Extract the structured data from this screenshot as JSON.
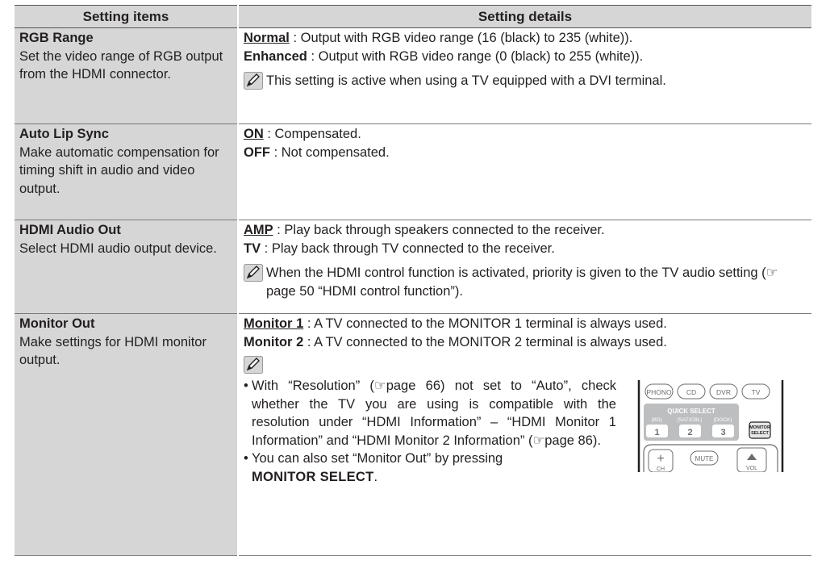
{
  "header": {
    "col1": "Setting items",
    "col2": "Setting details"
  },
  "rows": [
    {
      "title": "RGB Range",
      "desc": "Set the video range of RGB output from the HDMI connector.",
      "options": [
        {
          "key": "Normal",
          "text": " : Output with RGB video range (16 (black) to 235 (white))."
        },
        {
          "key": "Enhanced",
          "text": " : Output with RGB video range (0 (black) to 255 (white))."
        }
      ],
      "note": "This setting is active when using a TV equipped with a DVI terminal."
    },
    {
      "title": "Auto Lip Sync",
      "desc": "Make automatic compensation for timing shift in audio and video output.",
      "options": [
        {
          "key": "ON",
          "text": " : Compensated."
        },
        {
          "key": "OFF",
          "text": " : Not compensated."
        }
      ]
    },
    {
      "title": "HDMI Audio Out",
      "desc": "Select HDMI audio output device.",
      "options": [
        {
          "key": "AMP",
          "text": " : Play back through speakers connected to the receiver."
        },
        {
          "key": "TV",
          "text": " : Play back through TV connected to the receiver."
        }
      ],
      "note": "When the HDMI control function is activated, priority is given to the TV audio setting (☞page 50 “HDMI control function”)."
    },
    {
      "title": "Monitor Out",
      "desc": "Make settings for HDMI monitor output.",
      "options": [
        {
          "key": "Monitor 1",
          "text": " : A TV connected to the MONITOR 1 terminal is always used."
        },
        {
          "key": "Monitor 2",
          "text": " : A TV connected to the MONITOR 2 terminal is always used."
        }
      ],
      "bullets": [
        "With “Resolution” (☞page 66) not set to “Auto”, check whether the TV you are using is compatible with the resolution under “HDMI Information” – “HDMI Monitor 1 Information” and “HDMI Monitor 2 Information” (☞page 86).",
        "You can also set “Monitor Out” by pressing"
      ],
      "button_name": "MONITOR SELECT",
      "button_suffix": "."
    }
  ],
  "remote": {
    "top_buttons": [
      "PHONO",
      "CD",
      "DVR",
      "TV"
    ],
    "quick_select_label": "QUICK SELECT",
    "sub_labels": [
      "(BD)",
      "(SAT/CBL)",
      "(DOCK)"
    ],
    "numbers": [
      "1",
      "2",
      "3"
    ],
    "monitor_select_line1": "MONITOR",
    "monitor_select_line2": "SELECT",
    "ch_symbol": "+",
    "ch_label": "CH",
    "mute_label": "MUTE",
    "vol_label": "VOL"
  }
}
